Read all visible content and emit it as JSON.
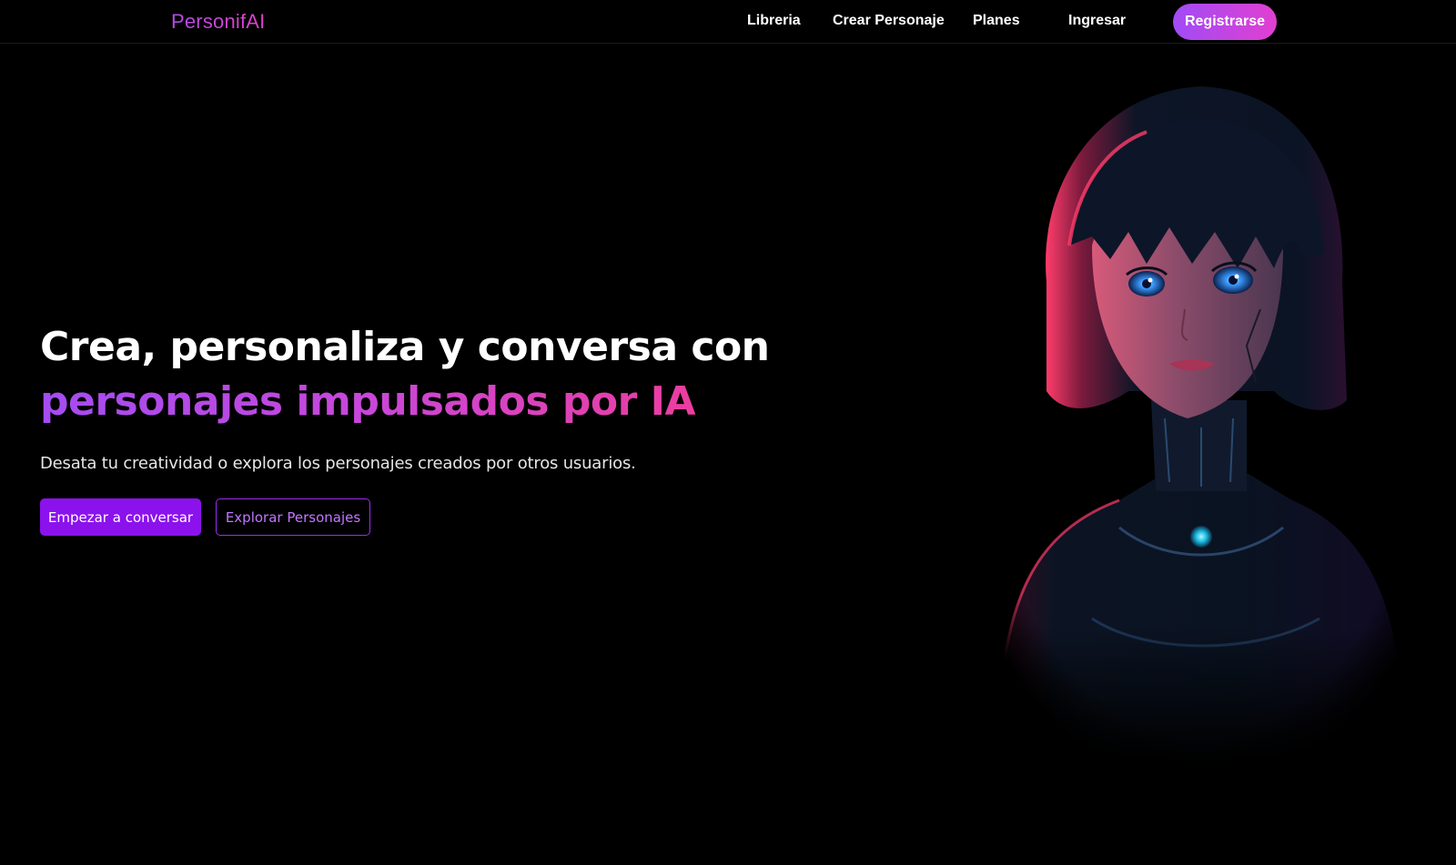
{
  "header": {
    "brand": "PersonifAI",
    "nav": {
      "libreria": "Libreria",
      "crear_personaje": "Crear Personaje",
      "planes": "Planes",
      "ingresar": "Ingresar"
    },
    "register_label": "Registrarse"
  },
  "hero": {
    "title_line1": "Crea, personaliza y conversa con",
    "title_line2": "personajes impulsados por IA",
    "subtitle": "Desata tu creatividad o explora los personajes creados por otros usuarios.",
    "primary_button": "Empezar a conversar",
    "secondary_button": "Explorar Personajes",
    "image": "ai-character-portrait"
  },
  "colors": {
    "background": "#000000",
    "accent_purple": "#8b12ec",
    "gradient_start": "#a04cf5",
    "gradient_end": "#e13fd0",
    "title_gradient_end": "#ec3d9f"
  }
}
